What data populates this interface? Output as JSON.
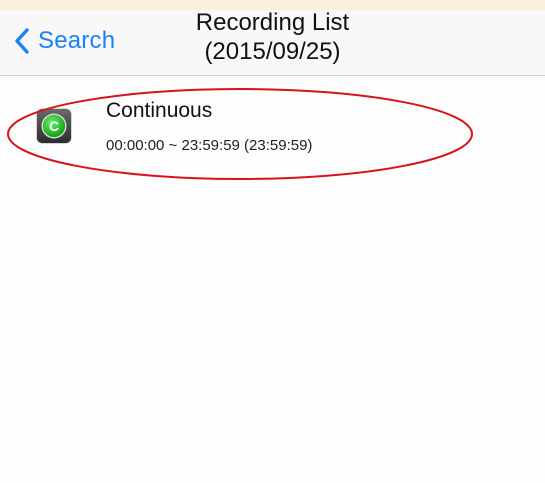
{
  "nav": {
    "back_label": "Search",
    "title_line1": "Recording List",
    "title_line2": "(2015/09/25)",
    "tint_color": "#1a82f7"
  },
  "recordings": [
    {
      "icon": "record-type-continuous-icon",
      "icon_letter": "C",
      "title": "Continuous",
      "subtitle": "00:00:00 ~ 23:59:59 (23:59:59)"
    }
  ],
  "annotation": {
    "shape": "ellipse",
    "color": "#d6141a"
  }
}
